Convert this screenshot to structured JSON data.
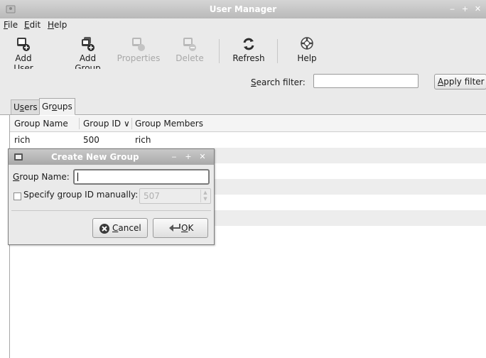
{
  "window": {
    "title": "User Manager"
  },
  "menu": {
    "file": "File",
    "edit": "Edit",
    "help": "Help"
  },
  "toolbar": {
    "add_user": "Add User",
    "add_group": "Add Group",
    "properties": "Properties",
    "delete": "Delete",
    "refresh": "Refresh",
    "help": "Help"
  },
  "search": {
    "label": "Search filter:",
    "value": "",
    "apply": "Apply filter"
  },
  "tabs": [
    {
      "label": "Users"
    },
    {
      "label": "Groups"
    }
  ],
  "table": {
    "columns": [
      "Group Name",
      "Group ID",
      "Group Members"
    ],
    "sort_indicator": "∨",
    "rows": [
      {
        "name": "rich",
        "id": "500",
        "members": "rich"
      }
    ]
  },
  "dialog": {
    "title": "Create New Group",
    "group_name_label": "Group Name:",
    "group_name_value": "",
    "specify_gid_label": "Specify group ID manually:",
    "specify_gid_checked": false,
    "gid_value": "507",
    "cancel": "Cancel",
    "ok": "OK"
  }
}
